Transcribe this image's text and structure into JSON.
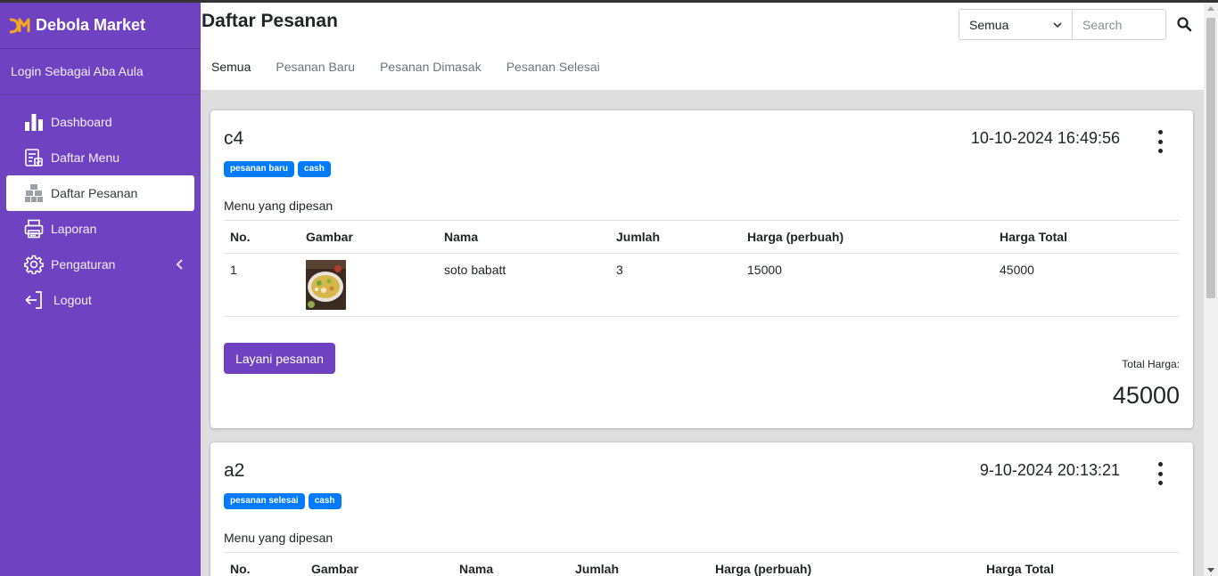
{
  "sidebar": {
    "brand": "Debola Market",
    "login_as": "Login Sebagai Aba Aula",
    "items": [
      {
        "label": "Dashboard",
        "icon": "bar-chart-icon"
      },
      {
        "label": "Daftar Menu",
        "icon": "menu-list-icon"
      },
      {
        "label": "Daftar Pesanan",
        "icon": "boxes-icon",
        "active": true
      },
      {
        "label": "Laporan",
        "icon": "printer-icon"
      },
      {
        "label": "Pengaturan",
        "icon": "gear-icon",
        "has_submenu": true
      },
      {
        "label": "Logout",
        "icon": "logout-icon"
      }
    ]
  },
  "header": {
    "title": "Daftar Pesanan",
    "filter": {
      "selected": "Semua"
    },
    "search": {
      "placeholder": "Search"
    },
    "tabs": [
      "Semua",
      "Pesanan Baru",
      "Pesanan Dimasak",
      "Pesanan Selesai"
    ]
  },
  "table_headers": [
    "No.",
    "Gambar",
    "Nama",
    "Jumlah",
    "Harga (perbuah)",
    "Harga Total"
  ],
  "orders": [
    {
      "code": "c4",
      "time": "10-10-2024 16:49:56",
      "badges": [
        "pesanan baru",
        "cash"
      ],
      "menu_label": "Menu yang dipesan",
      "items": [
        {
          "no": "1",
          "image": "soup-dish-image",
          "name": "soto babatt",
          "qty": "3",
          "price": "15000",
          "total": "45000"
        }
      ],
      "action": "Layani pesanan",
      "total_label": "Total Harga:",
      "total": "45000"
    },
    {
      "code": "a2",
      "time": "9-10-2024 20:13:21",
      "badges": [
        "pesanan selesai",
        "cash"
      ],
      "menu_label": "Menu yang dipesan"
    }
  ],
  "colors": {
    "primary": "#6f42c1",
    "badge": "#007bff"
  }
}
